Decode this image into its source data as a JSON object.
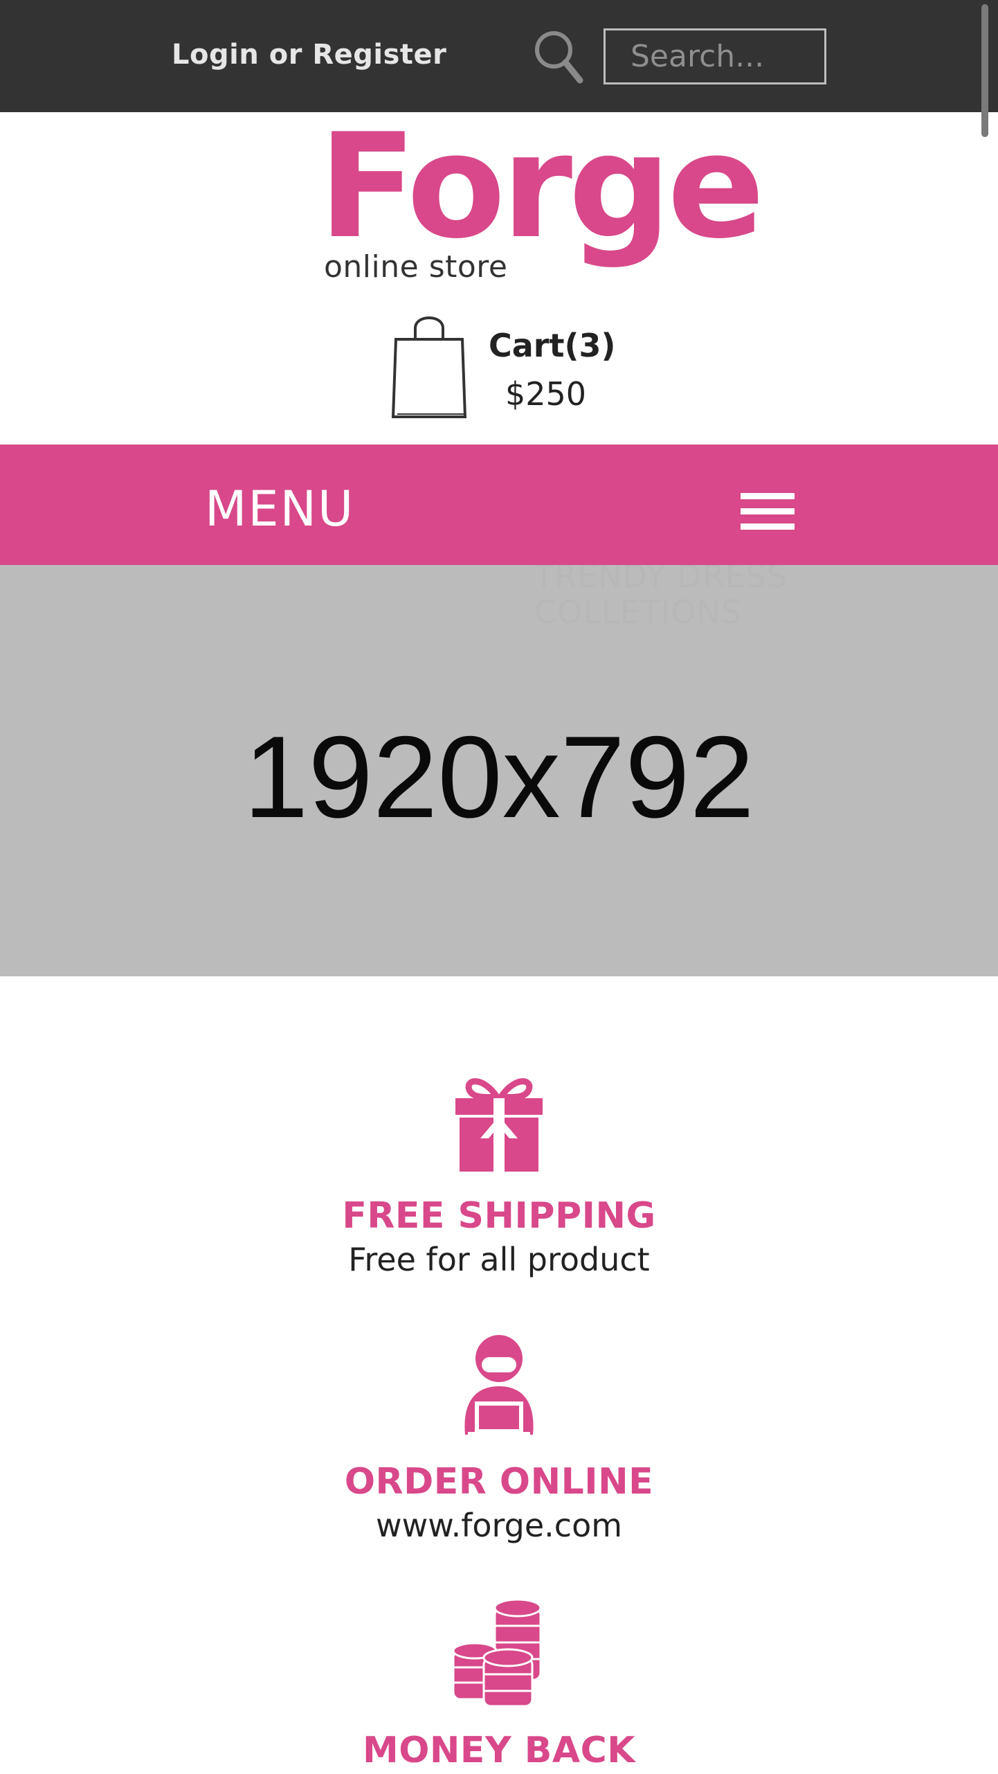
{
  "header": {
    "login_link": "Login or Register",
    "search_placeholder": "Search..."
  },
  "logo": {
    "word": "Forge",
    "subtitle": "online store"
  },
  "cart": {
    "label": "Cart(3)",
    "total": "$250"
  },
  "nav": {
    "menu_label": "MENU"
  },
  "banner": {
    "dimensions": "1920x792",
    "caption_line1": "TRENDY DRESS",
    "caption_line2": "COLLETIONS"
  },
  "features": [
    {
      "icon": "gift-icon",
      "title": "FREE SHIPPING",
      "subtitle": "Free for all product"
    },
    {
      "icon": "support-agent-icon",
      "title": "ORDER ONLINE",
      "subtitle": "www.forge.com"
    },
    {
      "icon": "coins-icon",
      "title": "MONEY BACK",
      "subtitle": ""
    }
  ],
  "colors": {
    "accent": "#d8488a",
    "topbar": "#333333",
    "banner_placeholder": "#bbbbbb"
  }
}
